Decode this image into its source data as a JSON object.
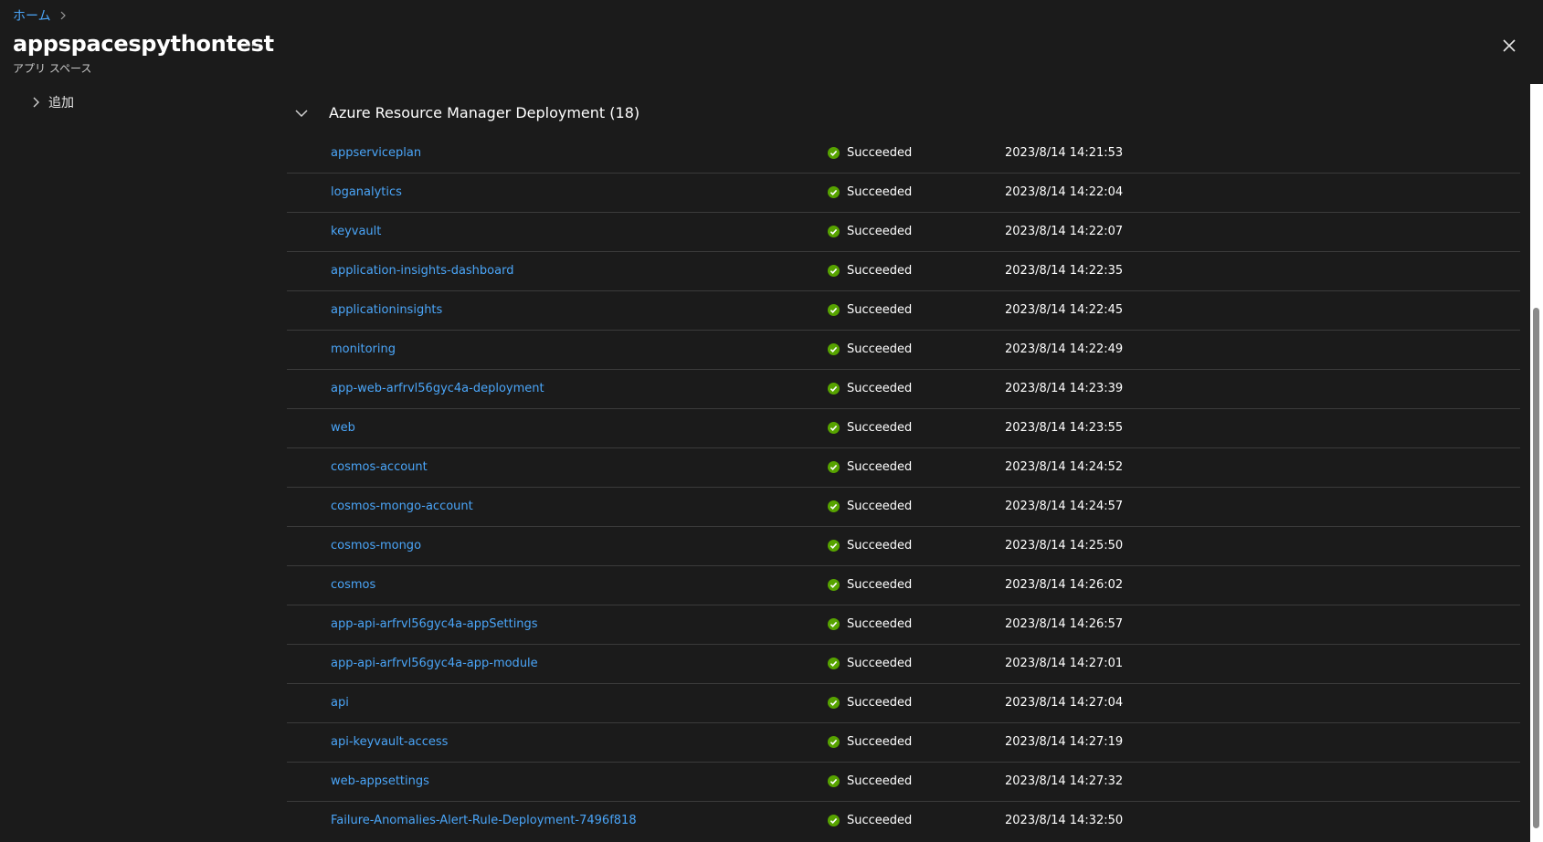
{
  "breadcrumb": {
    "home": "ホーム"
  },
  "header": {
    "title": "appspacespythontest",
    "subtitle": "アプリ スペース",
    "more": "···"
  },
  "tree": {
    "item_label": "追加"
  },
  "group": {
    "title": "Azure Resource Manager Deployment (18)"
  },
  "deployments": [
    {
      "name": "appserviceplan",
      "status": "Succeeded",
      "time": "2023/8/14 14:21:53"
    },
    {
      "name": "loganalytics",
      "status": "Succeeded",
      "time": "2023/8/14 14:22:04"
    },
    {
      "name": "keyvault",
      "status": "Succeeded",
      "time": "2023/8/14 14:22:07"
    },
    {
      "name": "application-insights-dashboard",
      "status": "Succeeded",
      "time": "2023/8/14 14:22:35"
    },
    {
      "name": "applicationinsights",
      "status": "Succeeded",
      "time": "2023/8/14 14:22:45"
    },
    {
      "name": "monitoring",
      "status": "Succeeded",
      "time": "2023/8/14 14:22:49"
    },
    {
      "name": "app-web-arfrvl56gyc4a-deployment",
      "status": "Succeeded",
      "time": "2023/8/14 14:23:39"
    },
    {
      "name": "web",
      "status": "Succeeded",
      "time": "2023/8/14 14:23:55"
    },
    {
      "name": "cosmos-account",
      "status": "Succeeded",
      "time": "2023/8/14 14:24:52"
    },
    {
      "name": "cosmos-mongo-account",
      "status": "Succeeded",
      "time": "2023/8/14 14:24:57"
    },
    {
      "name": "cosmos-mongo",
      "status": "Succeeded",
      "time": "2023/8/14 14:25:50"
    },
    {
      "name": "cosmos",
      "status": "Succeeded",
      "time": "2023/8/14 14:26:02"
    },
    {
      "name": "app-api-arfrvl56gyc4a-appSettings",
      "status": "Succeeded",
      "time": "2023/8/14 14:26:57"
    },
    {
      "name": "app-api-arfrvl56gyc4a-app-module",
      "status": "Succeeded",
      "time": "2023/8/14 14:27:01"
    },
    {
      "name": "api",
      "status": "Succeeded",
      "time": "2023/8/14 14:27:04"
    },
    {
      "name": "api-keyvault-access",
      "status": "Succeeded",
      "time": "2023/8/14 14:27:19"
    },
    {
      "name": "web-appsettings",
      "status": "Succeeded",
      "time": "2023/8/14 14:27:32"
    },
    {
      "name": "Failure-Anomalies-Alert-Rule-Deployment-7496f818",
      "status": "Succeeded",
      "time": "2023/8/14 14:32:50"
    }
  ],
  "icons": {
    "breadcrumb_separator": "chevron-right-icon",
    "close": "close-icon",
    "tree_expand": "chevron-right-icon",
    "group_collapse": "chevron-down-icon",
    "status": "success-check-icon"
  },
  "colors": {
    "background": "#1b1b1b",
    "link": "#4aa5f8",
    "success": "#57a300",
    "divider": "#3b3b3b"
  }
}
